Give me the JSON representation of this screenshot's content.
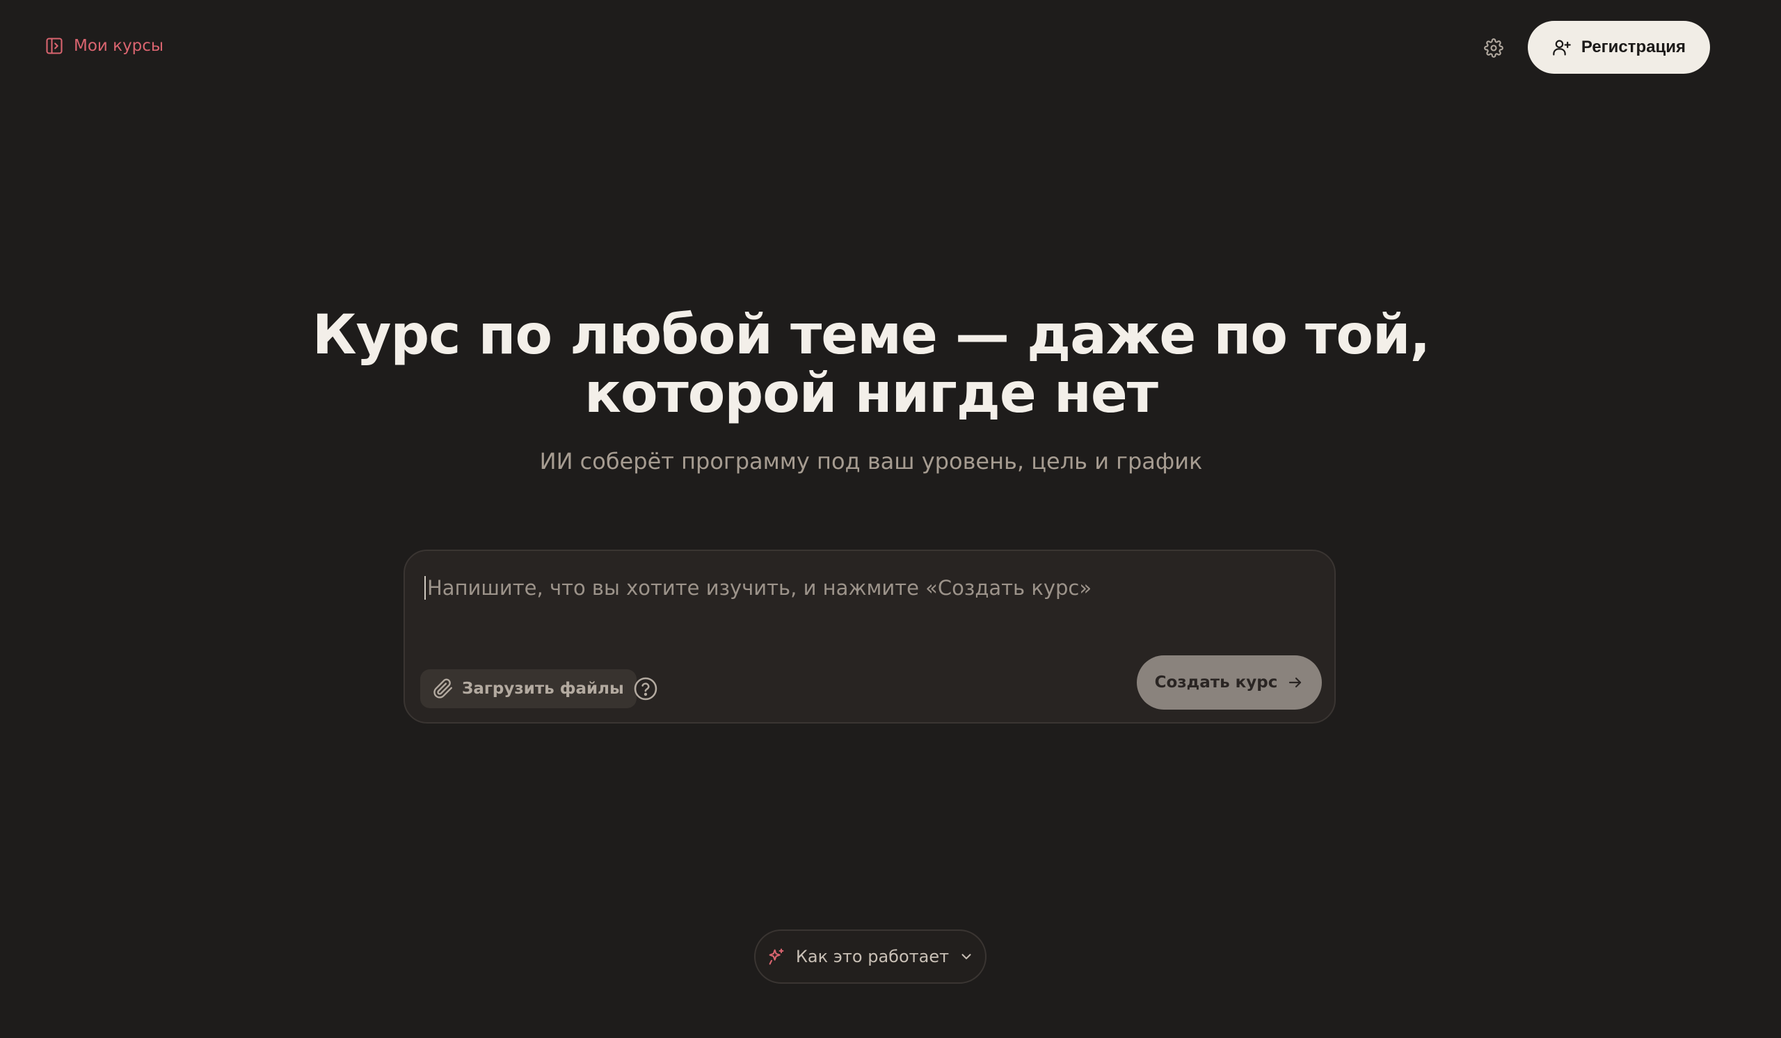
{
  "header": {
    "my_courses_label": "Мои курсы",
    "settings_icon": "gear-icon",
    "register_label": "Регистрация",
    "register_icon": "user-plus-icon"
  },
  "hero": {
    "title_line1": "Курс по любой теме — даже по той,",
    "title_line2": "которой нигде нет",
    "subtitle": "ИИ соберёт программу под ваш уровень, цель и график"
  },
  "composer": {
    "placeholder": "Напишите, что вы хотите изучить, и нажмите «Создать курс»",
    "upload_label": "Загрузить файлы",
    "help_icon": "question-circle-icon",
    "create_label": "Создать курс"
  },
  "footer": {
    "how_it_works_label": "Как это работает"
  },
  "colors": {
    "background": "#1e1c1b",
    "accent": "#d9646f",
    "register_bg": "#f1ede6",
    "create_bg": "#8a837d"
  }
}
